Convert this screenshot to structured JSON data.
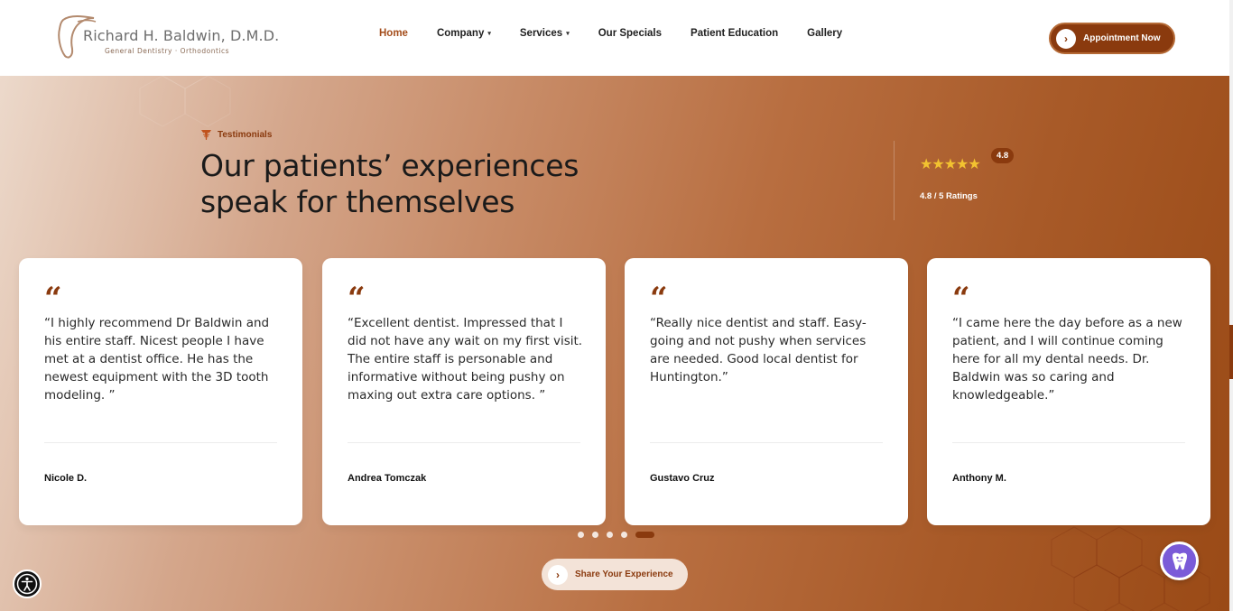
{
  "header": {
    "logo_name": "Richard H. Baldwin, D.M.D.",
    "logo_tagline": "General Dentistry · Orthodontics",
    "nav": [
      {
        "label": "Home",
        "active": true,
        "dropdown": false
      },
      {
        "label": "Company",
        "active": false,
        "dropdown": true
      },
      {
        "label": "Services",
        "active": false,
        "dropdown": true
      },
      {
        "label": "Our Specials",
        "active": false,
        "dropdown": false
      },
      {
        "label": "Patient Education",
        "active": false,
        "dropdown": false
      },
      {
        "label": "Gallery",
        "active": false,
        "dropdown": false
      }
    ],
    "cta_label": "Appointment Now"
  },
  "testimonials": {
    "eyebrow": "Testimonials",
    "heading_line1": "Our patients’ experiences",
    "heading_line2": "speak for themselves",
    "rating_stars": "★★★★★",
    "rating_badge": "4.8",
    "rating_text": "4.8 / 5 Ratings",
    "cards": [
      {
        "quote": "“I highly recommend Dr Baldwin and his entire staff. Nicest people I have met at a dentist office. He has the newest equipment with the 3D tooth modeling. ”",
        "author": "Nicole D."
      },
      {
        "quote": "“Excellent dentist. Impressed that I did not have any wait on my first visit. The entire staff is personable and informative without being pushy on maxing out extra care options. ”",
        "author": "Andrea Tomczak"
      },
      {
        "quote": "“Really nice dentist and staff. Easy-going and not pushy when services are needed. Good local dentist for Huntington.”",
        "author": "Gustavo Cruz"
      },
      {
        "quote": "“I came here the day before as a new patient, and I will continue coming here for all my dental needs. Dr. Baldwin was so caring and knowledgeable.”",
        "author": "Anthony M."
      }
    ],
    "active_slide": 5,
    "slide_count": 5,
    "share_label": "Share Your Experience"
  },
  "colors": {
    "brand": "#8a3a0e",
    "active_nav": "#a44d1b",
    "star": "#f2c230"
  }
}
